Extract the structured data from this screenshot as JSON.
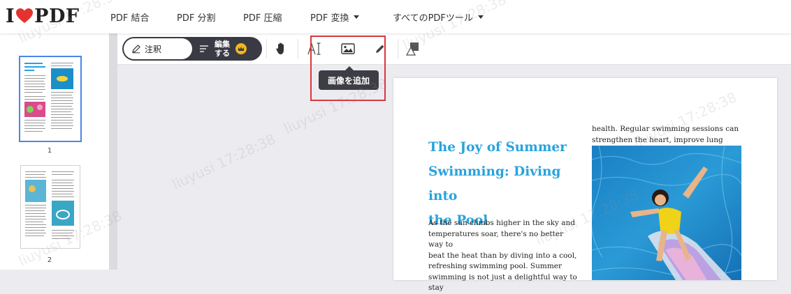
{
  "header": {
    "logo_prefix": "I",
    "logo_suffix": "PDF",
    "nav": [
      {
        "label": "PDF 結合"
      },
      {
        "label": "PDF 分割"
      },
      {
        "label": "PDF 圧縮"
      },
      {
        "label": "PDF 変換"
      },
      {
        "label": "すべてのPDFツール"
      }
    ]
  },
  "sidebar": {
    "pages": [
      {
        "number": "1",
        "selected": true
      },
      {
        "number": "2",
        "selected": false
      }
    ]
  },
  "toolbar": {
    "annotate_label": "注釈",
    "edit_label_line1": "編集",
    "edit_label_line2": "する",
    "tooltip": "画像を追加",
    "icons": [
      "pencil-icon",
      "list-icon",
      "crown-icon",
      "hand-icon",
      "text-cursor-icon",
      "image-icon",
      "pen-icon",
      "shapes-icon"
    ]
  },
  "document": {
    "title_lines": [
      "The Joy of Summer",
      "Swimming: Diving into",
      "the Pool"
    ],
    "left_lines": [
      "As the sun climbs higher in the sky and",
      "temperatures soar, there's no better way to",
      "beat the heat than by diving into a cool,",
      "refreshing swimming pool. Summer",
      "swimming is not just a delightful way to stay"
    ],
    "right_lines": [
      "health. Regular swimming sessions can",
      "strengthen the heart, improve lung capacity,"
    ]
  },
  "watermark": "liuyusi 17:28:38",
  "colors": {
    "accent_red": "#e5322d",
    "title_blue": "#27a3dd",
    "toolbar_dark": "#3a3a44",
    "highlight_red": "#d9363e",
    "crown_gold": "#f2b61b"
  }
}
